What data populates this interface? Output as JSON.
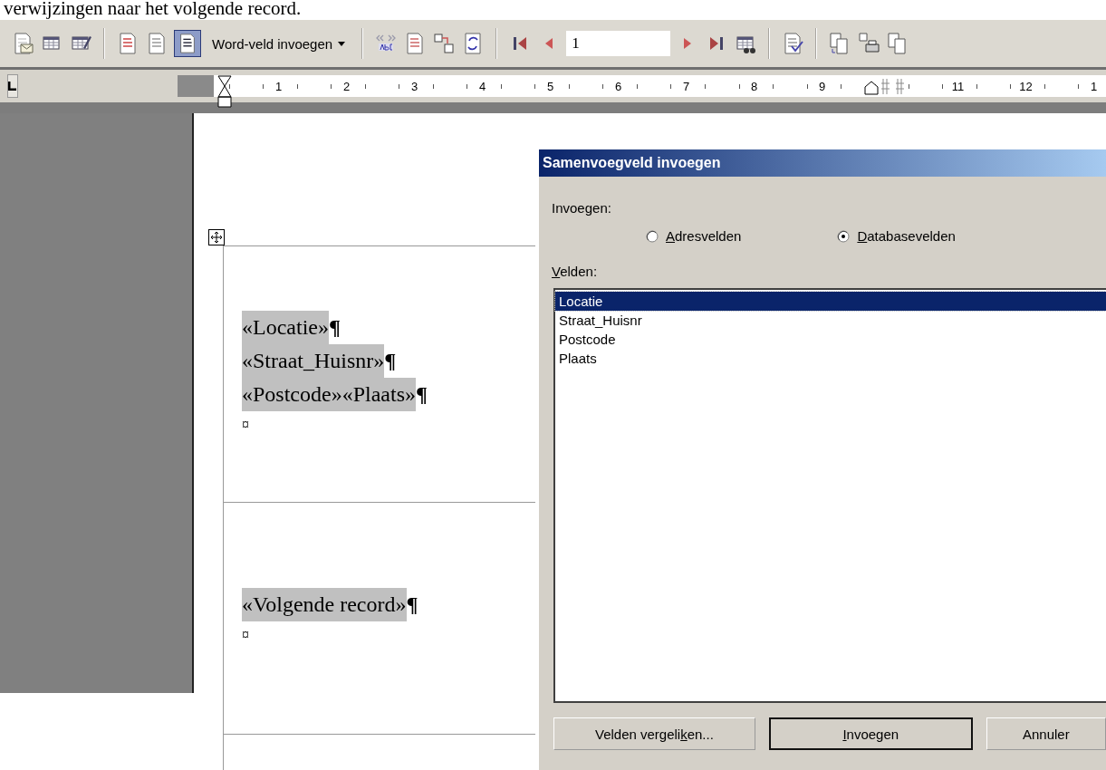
{
  "caption": "verwijzingen naar het volgende record.",
  "toolbar": {
    "insert_word_field": "Word-veld invoegen",
    "record_number": "1",
    "view_merged_data_pressed": true
  },
  "ruler": {
    "marks": [
      {
        "kind": "number",
        "text": "1"
      },
      {
        "kind": "number",
        "text": "2"
      },
      {
        "kind": "number",
        "text": "3"
      },
      {
        "kind": "number",
        "text": "4"
      },
      {
        "kind": "number",
        "text": "5"
      },
      {
        "kind": "number",
        "text": "6"
      },
      {
        "kind": "number",
        "text": "7"
      },
      {
        "kind": "number",
        "text": "8"
      },
      {
        "kind": "number",
        "text": "9"
      },
      {
        "kind": "margin"
      },
      {
        "kind": "number",
        "text": "11"
      },
      {
        "kind": "number",
        "text": "12"
      },
      {
        "kind": "number",
        "text": "1"
      }
    ]
  },
  "document": {
    "cells": [
      {
        "lines": [
          {
            "field": "«Locatie»",
            "mark": "¶"
          },
          {
            "field": "«Straat_Huisnr»",
            "mark": "¶"
          },
          {
            "field": "«Postcode»«Plaats»",
            "mark": "¶"
          }
        ],
        "end_mark": "¤"
      },
      {
        "lines": [
          {
            "field": "«Volgende record»",
            "mark": "¶"
          }
        ],
        "end_mark": "¤"
      }
    ]
  },
  "dialog": {
    "title": "Samenvoegveld invoegen",
    "insert_label": "Invoegen:",
    "options": [
      {
        "key": "A",
        "rest": "dresvelden",
        "selected": false
      },
      {
        "key": "D",
        "rest": "atabasevelden",
        "selected": true
      }
    ],
    "fields_label": {
      "key": "V",
      "rest": "elden:"
    },
    "fields": [
      {
        "text": "Locatie",
        "selected": true
      },
      {
        "text": "Straat_Huisnr",
        "selected": false
      },
      {
        "text": "Postcode",
        "selected": false
      },
      {
        "text": "Plaats",
        "selected": false
      }
    ],
    "buttons": [
      {
        "before": "Velden vergeli",
        "key": "k",
        "rest": "en...",
        "default": false
      },
      {
        "key": "I",
        "rest": "nvoegen",
        "default": true
      },
      {
        "rest": "Annuler",
        "default": false
      }
    ]
  }
}
